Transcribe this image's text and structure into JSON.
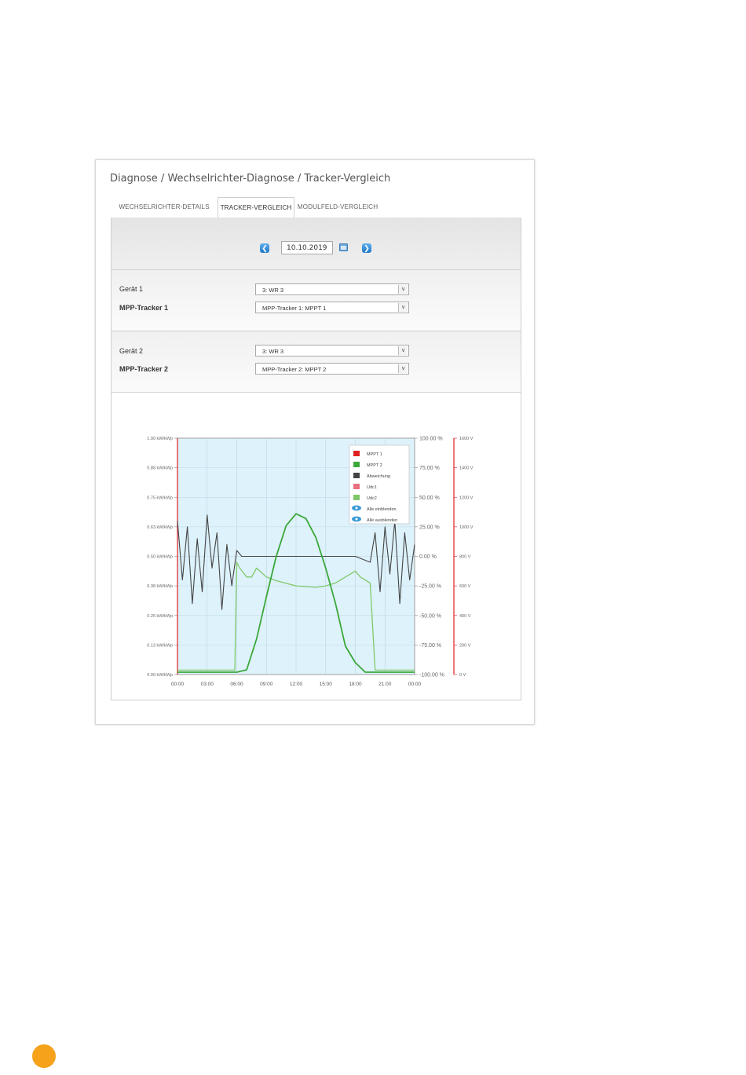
{
  "breadcrumb": "Diagnose / Wechselrichter-Diagnose / Tracker-Vergleich",
  "tabs": [
    {
      "label": "WECHSELRICHTER-DETAILS",
      "active": false
    },
    {
      "label": "TRACKER-VERGLEICH",
      "active": true
    },
    {
      "label": "MODULFELD-VERGLEICH",
      "active": false
    }
  ],
  "date": {
    "value": "10.10.2019",
    "prev_icon": "arrow-left-icon",
    "next_icon": "arrow-right-icon",
    "calendar_icon": "calendar-icon"
  },
  "device1": {
    "label": "Gerät 1",
    "value": "3: WR 3",
    "tracker_label": "MPP-Tracker 1",
    "tracker_value": "MPP-Tracker 1: MPPT 1"
  },
  "device2": {
    "label": "Gerät 2",
    "value": "3: WR 3",
    "tracker_label": "MPP-Tracker 2",
    "tracker_value": "MPP-Tracker 2: MPPT 2"
  },
  "colors": {
    "accent": "#1f78c8",
    "mppt1": "#e02020",
    "mppt2": "#3aa83a",
    "deviation": "#444444",
    "udc1": "#e87080",
    "udc2": "#7fc86a",
    "plot_bg": "#def2fb",
    "page_dot": "#f7a21b"
  },
  "chart_data": {
    "type": "line",
    "x_ticks": [
      "00:00",
      "03:00",
      "06:00",
      "09:00",
      "12:00",
      "15:00",
      "18:00",
      "21:00",
      "00:00"
    ],
    "y_left_ticks": [
      "1.00 kW/kWp",
      "0.88 kW/kWp",
      "0.75 kW/kWp",
      "0.63 kW/kWp",
      "0.50 kW/kWp",
      "0.38 kW/kWp",
      "0.25 kW/kWp",
      "0.13 kW/kWp",
      "0.00 kW/kWp"
    ],
    "y_mid_ticks": [
      "100.00 %",
      "75.00 %",
      "50.00 %",
      "25.00 %",
      "0.00 %",
      "-25.00 %",
      "-50.00 %",
      "-75.00 %",
      "-100.00 %"
    ],
    "y_right_ticks": [
      "1600 V",
      "1400 V",
      "1200 V",
      "1000 V",
      "800 V",
      "600 V",
      "400 V",
      "200 V",
      "0 V"
    ],
    "y_left_range": [
      0,
      1.0
    ],
    "y_mid_range": [
      -100,
      100
    ],
    "y_right_range": [
      0,
      1600
    ],
    "grid": true,
    "legend_position": "top-right",
    "legend": [
      {
        "label": "MPPT 1",
        "color": "#e02020",
        "icon": "square"
      },
      {
        "label": "MPPT 2",
        "color": "#3aa83a",
        "icon": "square"
      },
      {
        "label": "Abweichung",
        "color": "#444444",
        "icon": "square"
      },
      {
        "label": "Udc1",
        "color": "#e87080",
        "icon": "square"
      },
      {
        "label": "Udc2",
        "color": "#7fc86a",
        "icon": "square"
      },
      {
        "label": "Alle einblenden",
        "color": "#3a9ad9",
        "icon": "eye-icon"
      },
      {
        "label": "Alle ausblenden",
        "color": "#3a9ad9",
        "icon": "eye-icon"
      }
    ],
    "series": [
      {
        "name": "MPPT 2",
        "axis": "left",
        "x": [
          0,
          6,
          7,
          8,
          9,
          10,
          11,
          12,
          12.5,
          13,
          14,
          15,
          16,
          17,
          18,
          19,
          20,
          21,
          22,
          24
        ],
        "values": [
          0.01,
          0.01,
          0.02,
          0.15,
          0.33,
          0.5,
          0.63,
          0.68,
          0.67,
          0.66,
          0.58,
          0.45,
          0.3,
          0.12,
          0.05,
          0.01,
          0.01,
          0.01,
          0.01,
          0.01
        ]
      },
      {
        "name": "Udc2",
        "axis": "right",
        "x": [
          0,
          5.8,
          6,
          6.3,
          7,
          7.5,
          8,
          9,
          10,
          12,
          14,
          15,
          16,
          17,
          18,
          18.5,
          19.5,
          20,
          21,
          24
        ],
        "values": [
          30,
          30,
          760,
          720,
          660,
          660,
          720,
          660,
          635,
          600,
          590,
          600,
          620,
          660,
          700,
          660,
          620,
          30,
          30,
          30
        ]
      },
      {
        "name": "Abweichung",
        "axis": "mid",
        "x": [
          0,
          0.5,
          1,
          1.5,
          2,
          2.5,
          3,
          3.5,
          4,
          4.5,
          5,
          5.5,
          6,
          6.5,
          7,
          9,
          12,
          15,
          18,
          19.5,
          20,
          20.5,
          21,
          21.5,
          22,
          22.5,
          23,
          23.5,
          24
        ],
        "values": [
          30,
          -20,
          25,
          -40,
          15,
          -30,
          35,
          -10,
          20,
          -45,
          10,
          -25,
          5,
          0,
          0,
          0,
          0,
          0,
          0,
          -5,
          20,
          -30,
          25,
          -15,
          30,
          -40,
          20,
          -20,
          10
        ]
      }
    ]
  }
}
